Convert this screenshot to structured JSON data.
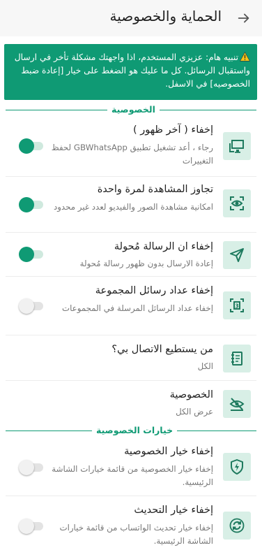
{
  "header": {
    "title": "الحماية والخصوصية",
    "back_icon": "arrow-right-icon"
  },
  "alert": {
    "text": "تنبيه هام: عزيزي المستخدم، اذا واجهتك مشكلة تأخر في ارسال واستقبال الرسائل. كل ما عليك هو الضغط على خيار [إعادة ضبط الخصوصيه] في الاسفل.",
    "icon": "warning-icon"
  },
  "sections": {
    "privacy": "الخصوصية",
    "privacy_options": "خيارات الخصوصية"
  },
  "colors": {
    "accent": "#0f9a74",
    "icon_bg": "#d8efe6"
  },
  "rows": [
    {
      "title": "إخفاء ( آخر ظهور )",
      "subtitle": "رجاء ، أعد تشغيل تطبيق GBWhatsApp لحفظ التغييرات",
      "icon": "monitor-icon",
      "toggle": true
    },
    {
      "title": "تجاوز المشاهدة لمرة واحدة",
      "subtitle": "امكانية مشاهدة الصور والفيديو لعدد غير محدود",
      "icon": "eye-scan-icon",
      "toggle": true
    },
    {
      "title": "إخفاء ان الرسالة مُحولة",
      "subtitle": "إعادة الارسال بدون ظهور رسالة مُحولة",
      "icon": "send-icon",
      "toggle": true
    },
    {
      "title": "إخفاء عداد رسائل المجموعة",
      "subtitle": "إخفاء عداد الرسائل المرسلة في المجموعات",
      "icon": "counter-icon",
      "toggle": false
    },
    {
      "title": "من يستطيع الاتصال بي؟",
      "subtitle": "الكل",
      "icon": "phonebook-icon"
    },
    {
      "title": "الخصوصية",
      "subtitle": "عرض الكل",
      "icon": "hidden-eye-icon"
    },
    {
      "title": "إخفاء خيار الخصوصية",
      "subtitle": "إخفاء خيار الخصوصية من قائمة خيارات الشاشة الرئيسية.",
      "icon": "shield-icon",
      "toggle": false
    },
    {
      "title": "إخفاء خيار التحديث",
      "subtitle": "إخفاء خيار تحديث الواتساب من قائمة خيارات الشاشة الرئيسية.",
      "icon": "refresh-icon",
      "toggle": false
    }
  ]
}
